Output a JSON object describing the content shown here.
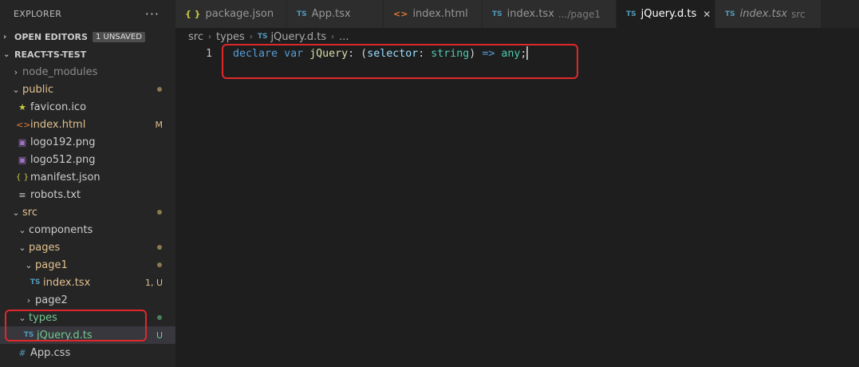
{
  "sidebar": {
    "title": "EXPLORER",
    "more": "···",
    "open_editors": {
      "label": "OPEN EDITORS",
      "badge": "1 UNSAVED"
    },
    "project": {
      "label": "REACT-TS-TEST"
    },
    "tree": [
      {
        "label": "node_modules",
        "type": "folder-closed"
      },
      {
        "label": "public",
        "type": "folder-open"
      },
      {
        "label": "favicon.ico",
        "type": "file",
        "icon": "star-icon"
      },
      {
        "label": "index.html",
        "type": "file",
        "icon": "html-icon",
        "decoration": "M"
      },
      {
        "label": "logo192.png",
        "type": "file",
        "icon": "image-icon"
      },
      {
        "label": "logo512.png",
        "type": "file",
        "icon": "image-icon"
      },
      {
        "label": "manifest.json",
        "type": "file",
        "icon": "json-icon"
      },
      {
        "label": "robots.txt",
        "type": "file",
        "icon": "text-icon"
      },
      {
        "label": "src",
        "type": "folder-open"
      },
      {
        "label": "components",
        "type": "folder-open"
      },
      {
        "label": "pages",
        "type": "folder-open"
      },
      {
        "label": "page1",
        "type": "folder-open"
      },
      {
        "label": "index.tsx",
        "type": "file",
        "icon": "ts-icon",
        "decoration": "1, U"
      },
      {
        "label": "page2",
        "type": "folder-closed"
      },
      {
        "label": "types",
        "type": "folder-open"
      },
      {
        "label": "jQuery.d.ts",
        "type": "file",
        "icon": "ts-icon",
        "decoration": "U"
      },
      {
        "label": "App.css",
        "type": "file",
        "icon": "hash-icon"
      }
    ],
    "icons": {
      "ts": "TS",
      "json": "{ }",
      "html": "<>",
      "hash": "#",
      "text": "≡",
      "star": "★",
      "image": "▣"
    }
  },
  "tabs": [
    {
      "label": "package.json",
      "icon": "{ }"
    },
    {
      "label": "App.tsx",
      "icon": "TS"
    },
    {
      "label": "index.html",
      "icon": "<>"
    },
    {
      "label": "index.tsx",
      "icon": "TS",
      "description": ".../page1"
    },
    {
      "label": "jQuery.d.ts",
      "icon": "TS"
    },
    {
      "label": "index.tsx",
      "icon": "TS",
      "description": "src"
    }
  ],
  "breadcrumb": {
    "parts": [
      "src",
      "types",
      "jQuery.d.ts",
      "..."
    ],
    "file_icon": "TS"
  },
  "editor": {
    "line_number": "1",
    "tokens": {
      "declare": "declare",
      "var": "var",
      "name": "jQuery",
      "colon1": ": (",
      "param": "selector",
      "colon2": ": ",
      "type": "string",
      "close": ") ",
      "arrow": "=>",
      "ret": "any",
      "semi": ";"
    }
  },
  "colors": {
    "background": "#1e1e1e",
    "sidebar": "#252526",
    "modified": "#e2c08d",
    "untracked": "#73c991",
    "annotation": "#e0282b"
  }
}
